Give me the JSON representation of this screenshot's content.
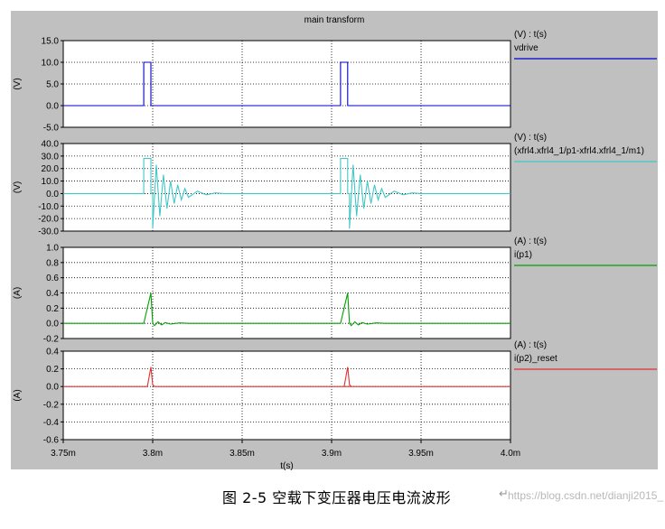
{
  "title": "main transform",
  "x_axis": {
    "label": "t(s)",
    "ticks": [
      "3.75m",
      "3.8m",
      "3.85m",
      "3.9m",
      "3.95m",
      "4.0m"
    ]
  },
  "caption": {
    "text": "图  2-5  空载下变压器电压电流波形",
    "return_mark": "↵"
  },
  "watermark": "https://blog.csdn.net/dianji2015_",
  "colors": {
    "background": "#c0c0c0",
    "plot": "#ffffff",
    "grid": "#000000"
  },
  "chart_data": [
    {
      "type": "line",
      "ylabel": "(V)",
      "header": "(V) : t(s)",
      "ylim": [
        -5,
        15
      ],
      "yticks": [
        "15.0",
        "10.0",
        "5.0",
        "0.0",
        "-5.0"
      ],
      "xlim": [
        0.00375,
        0.004
      ],
      "series": [
        {
          "name": "vdrive",
          "color": "#0000cc",
          "x": [
            0.00375,
            0.003795,
            0.003795,
            0.003799,
            0.003799,
            0.0038,
            0.0038,
            0.00385,
            0.003905,
            0.003905,
            0.003909,
            0.003909,
            0.00391,
            0.00391,
            0.004
          ],
          "y": [
            0,
            0,
            10,
            10,
            0,
            0,
            0,
            0,
            0,
            10,
            10,
            0,
            0,
            0,
            0
          ]
        }
      ]
    },
    {
      "type": "line",
      "ylabel": "(V)",
      "header": "(V) : t(s)",
      "ylim": [
        -30,
        40
      ],
      "yticks": [
        "40.0",
        "30.0",
        "20.0",
        "10.0",
        "0.0",
        "-10.0",
        "-20.0",
        "-30.0"
      ],
      "xlim": [
        0.00375,
        0.004
      ],
      "series": [
        {
          "name": "(xfrl4.xfrl4_1/p1-xfrl4.xfrl4_1/m1)",
          "color": "#40c8c8",
          "x": [
            0.00375,
            0.003795,
            0.003795,
            0.003799,
            0.003799,
            0.0038,
            0.0038,
            0.003802,
            0.003804,
            0.003806,
            0.003808,
            0.00381,
            0.003812,
            0.003814,
            0.003816,
            0.003818,
            0.00382,
            0.003825,
            0.00383,
            0.003835,
            0.00384,
            0.003905,
            0.003905,
            0.003909,
            0.003909,
            0.00391,
            0.00391,
            0.003912,
            0.003914,
            0.003916,
            0.003918,
            0.00392,
            0.003922,
            0.003924,
            0.003926,
            0.003928,
            0.00393,
            0.003935,
            0.00394,
            0.003945,
            0.00395,
            0.004
          ],
          "y": [
            0,
            0,
            28,
            28,
            0,
            0,
            -28,
            23,
            -18,
            15,
            -12,
            10,
            -8,
            7,
            -5,
            4,
            -3,
            2,
            -1,
            0.5,
            0,
            0,
            28,
            28,
            0,
            0,
            -28,
            23,
            -18,
            15,
            -12,
            10,
            -8,
            7,
            -5,
            4,
            -3,
            2,
            -1,
            0.5,
            0,
            0
          ]
        }
      ]
    },
    {
      "type": "line",
      "ylabel": "(A)",
      "header": "(A) : t(s)",
      "ylim": [
        -0.2,
        1.0
      ],
      "yticks": [
        "1.0",
        "0.8",
        "0.6",
        "0.4",
        "0.2",
        "0.0",
        "-0.2"
      ],
      "xlim": [
        0.00375,
        0.004
      ],
      "series": [
        {
          "name": "i(p1)",
          "color": "#00a000",
          "x": [
            0.00375,
            0.003795,
            0.003799,
            0.0038,
            0.003801,
            0.003803,
            0.003805,
            0.003807,
            0.00381,
            0.003815,
            0.00382,
            0.003905,
            0.003909,
            0.00391,
            0.003911,
            0.003913,
            0.003915,
            0.003917,
            0.00392,
            0.003925,
            0.00393,
            0.004
          ],
          "y": [
            0,
            0,
            0.4,
            0.0,
            -0.03,
            0.02,
            -0.02,
            0.01,
            -0.01,
            0.005,
            0,
            0,
            0.4,
            0.0,
            -0.03,
            0.02,
            -0.02,
            0.01,
            -0.01,
            0.005,
            0,
            0
          ]
        }
      ]
    },
    {
      "type": "line",
      "ylabel": "(A)",
      "header": "(A) : t(s)",
      "ylim": [
        -0.6,
        0.4
      ],
      "yticks": [
        "0.4",
        "0.2",
        "0.0",
        "-0.2",
        "-0.4",
        "-0.6"
      ],
      "xlim": [
        0.00375,
        0.004
      ],
      "series": [
        {
          "name": "i(p2)_reset",
          "color": "#e03030",
          "x": [
            0.00375,
            0.003797,
            0.003799,
            0.0038,
            0.003801,
            0.004,
            0.003907,
            0.003909,
            0.00391,
            0.003911
          ],
          "y": [
            0,
            0,
            0.22,
            0.02,
            0,
            0,
            0,
            0.22,
            0.02,
            0
          ]
        }
      ]
    }
  ]
}
